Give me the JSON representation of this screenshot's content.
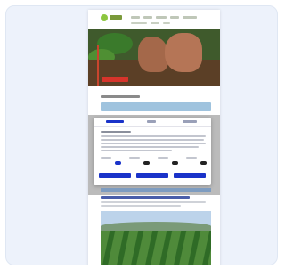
{
  "card": {
    "background": "#edf2fb"
  },
  "page": {
    "brand_color": "#8cc63f",
    "accent_color": "#1a33c9",
    "cta_color": "#d7342b"
  },
  "icons": {
    "logo": "sprout-logo-icon"
  }
}
